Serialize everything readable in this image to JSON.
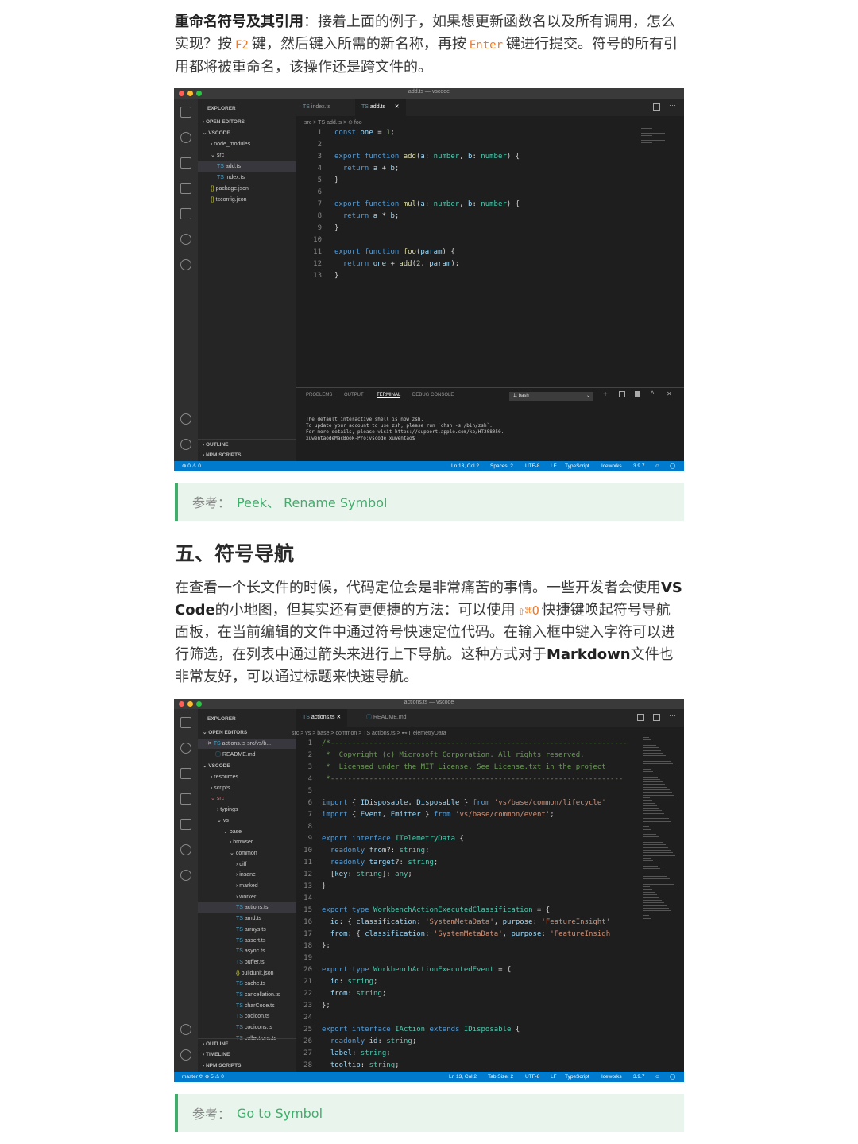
{
  "intro": {
    "bold": "重命名符号及其引用",
    "t1": "：接着上面的例子，如果想更新函数名以及所有调用，怎么实现？按",
    "key1": "F2",
    "t2": "键，然后键入所需的新名称，再按",
    "key2": "Enter",
    "t3": "键进行提交。符号的所有引用都将被重命名，该操作还是跨文件的。"
  },
  "win1": {
    "title": "add.ts — vscode",
    "sidebar": {
      "explorer": "EXPLORER",
      "open_editors": "OPEN EDITORS",
      "vscode": "VSCODE",
      "items": [
        "node_modules",
        "src",
        "add.ts",
        "index.ts",
        "package.json",
        "tsconfig.json"
      ],
      "outline": "OUTLINE",
      "npm": "NPM SCRIPTS"
    },
    "tabs": [
      "index.ts",
      "add.ts"
    ],
    "crumb": "src  >  TS add.ts  >  ⊙ foo",
    "lines": [
      "1",
      "2",
      "3",
      "4",
      "5",
      "6",
      "7",
      "8",
      "9",
      "10",
      "11",
      "12",
      "13"
    ],
    "panel_tabs": [
      "PROBLEMS",
      "OUTPUT",
      "TERMINAL",
      "DEBUG CONSOLE"
    ],
    "shell": "1: bash",
    "terminal": "The default interactive shell is now zsh.\nTo update your account to use zsh, please run `chsh -s /bin/zsh`.\nFor more details, please visit https://support.apple.com/kb/HT208050.\nxuwentaodeMacBook-Pro:vscode xuwentao$",
    "status_left": "⊗ 0 ⚠ 0",
    "status_right": [
      "Ln 13, Col 2",
      "Spaces: 2",
      "UTF-8",
      "LF",
      "TypeScript",
      "Iceworks",
      "3.9.7"
    ]
  },
  "ref1": {
    "label": "参考：",
    "value": "Peek、 Rename Symbol"
  },
  "heading": "五、符号导航",
  "para2": {
    "t1": "在查看一个长文件的时候，代码定位会是非常痛苦的事情。一些开发者会使用",
    "vs": "VS Code",
    "t2": "的小地图，但其实还有更便捷的方法：可以使用",
    "key": "⇧⌘O",
    "t3": "快捷键唤起符号导航面板，在当前编辑的文件中通过符号快速定位代码。在输入框中键入字符可以进行筛选，在列表中通过箭头来进行上下导航。这种方式对于",
    "md": "Markdown",
    "t4": "文件也非常友好，可以通过标题来快速导航。"
  },
  "win2": {
    "title": "actions.ts — vscode",
    "sidebar": {
      "explorer": "EXPLORER",
      "open_editors": "OPEN EDITORS",
      "oe1": "actions.ts  src/vs/b...",
      "oe2": "README.md",
      "vscode": "VSCODE",
      "items": [
        "resources",
        "scripts",
        "src",
        "typings",
        "vs",
        "base",
        "browser",
        "common",
        "diff",
        "insane",
        "marked",
        "worker",
        "actions.ts",
        "amd.ts",
        "arrays.ts",
        "assert.ts",
        "async.ts",
        "buffer.ts",
        "buildunit.json",
        "cache.ts",
        "cancellation.ts",
        "charCode.ts",
        "codicon.ts",
        "codicons.ts",
        "collections.ts"
      ],
      "outline": "OUTLINE",
      "timeline": "TIMELINE",
      "npm": "NPM SCRIPTS"
    },
    "tabs": [
      "actions.ts",
      "README.md"
    ],
    "crumb": "src > vs > base > common > TS actions.ts > ⊷ ITelemetryData",
    "lines": [
      "1",
      "2",
      "3",
      "4",
      "5",
      "6",
      "7",
      "8",
      "9",
      "10",
      "11",
      "12",
      "13",
      "14",
      "15",
      "16",
      "17",
      "18",
      "19",
      "20",
      "21",
      "22",
      "23",
      "24",
      "25",
      "26",
      "27",
      "28"
    ],
    "status_left": "master  ⟳  ⊗ 5 ⚠ 0",
    "status_right": [
      "Ln 13, Col 2",
      "Tab Size: 2",
      "UTF-8",
      "LF",
      "TypeScript",
      "Iceworks",
      "3.9.7"
    ]
  },
  "ref2": {
    "label": "参考：",
    "value": "Go to Symbol"
  }
}
